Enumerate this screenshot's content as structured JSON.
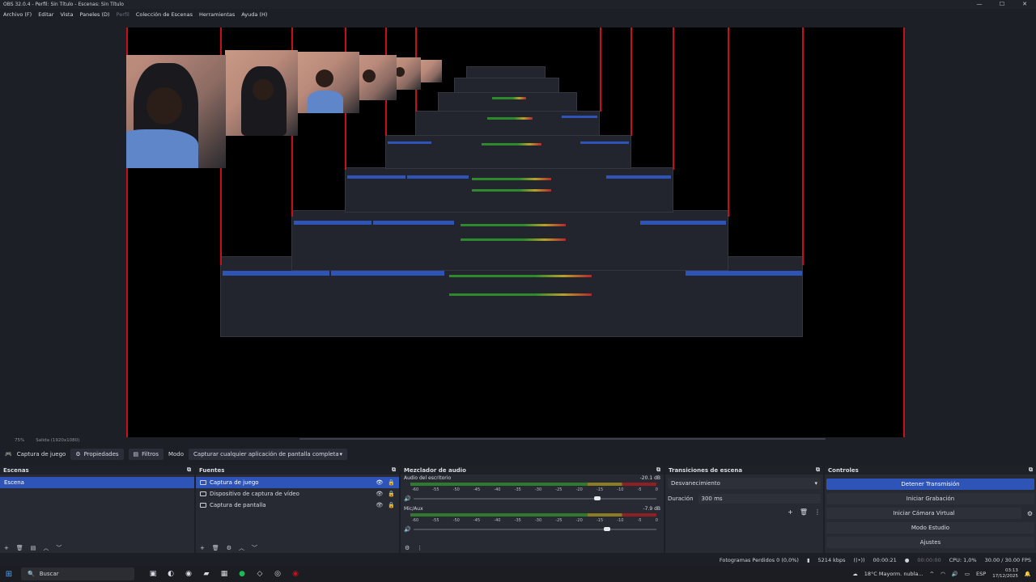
{
  "window": {
    "title": "OBS 32.0.4 - Perfil: Sin Título - Escenas: Sin Título",
    "controls": [
      "—",
      "☐",
      "✕"
    ]
  },
  "menu": {
    "items": [
      "Archivo (F)",
      "Editar",
      "Vista",
      "Paneles (D)"
    ],
    "disabled": "Perfil",
    "items2": [
      "Colección de Escenas",
      "Herramientas",
      "Ayuda (H)"
    ]
  },
  "preview": {
    "zoom": "75%",
    "output": "Salida (1920x1080)"
  },
  "source_toolbar": {
    "source_name": "Captura de juego",
    "properties": "Propiedades",
    "filters": "Filtros",
    "mode_label": "Modo",
    "mode_value": "Capturar cualquier aplicación de pantalla completa"
  },
  "scenes": {
    "title": "Escenas",
    "items": [
      "Escena"
    ]
  },
  "sources": {
    "title": "Fuentes",
    "items": [
      "Captura de juego",
      "Dispositivo de captura de vídeo",
      "Captura de pantalla"
    ]
  },
  "mixer": {
    "title": "Mezclador de audio",
    "channels": [
      {
        "name": "Audio del escritorio",
        "db": "-20.1 dB",
        "level": 0.91
      },
      {
        "name": "Mic/Aux",
        "db": "-7.9 dB",
        "level": 0.95
      }
    ],
    "ticks": [
      "-60",
      "-55",
      "-50",
      "-45",
      "-40",
      "-35",
      "-30",
      "-25",
      "-20",
      "-15",
      "-10",
      "-5",
      "0"
    ]
  },
  "transitions": {
    "title": "Transiciones de escena",
    "selected": "Desvanecimiento",
    "duration_label": "Duración",
    "duration_value": "300 ms"
  },
  "controls": {
    "title": "Controles",
    "stop_stream": "Detener Transmisión",
    "start_record": "Iniciar Grabación",
    "start_virtualcam": "Iniciar Cámara Virtual",
    "studio_mode": "Modo Estudio",
    "settings": "Ajustes"
  },
  "status": {
    "dropped_frames": "Fotogramas Perdidos 0 (0,0%)",
    "bitrate": "5214 kbps",
    "stream_time": "00:00:21",
    "record_time": "00:00:00",
    "cpu": "CPU: 1,0%",
    "fps": "30.00 / 30.00 FPS"
  },
  "taskbar": {
    "search_placeholder": "Buscar",
    "weather": "18°C  Mayorm. nubla...",
    "language": "ESP",
    "time": "03:13",
    "date": "17/12/2025"
  },
  "colors": {
    "accent": "#2f54b8",
    "record_red": "#c4111c",
    "panel": "#272a33",
    "bg": "#1d1f26"
  }
}
